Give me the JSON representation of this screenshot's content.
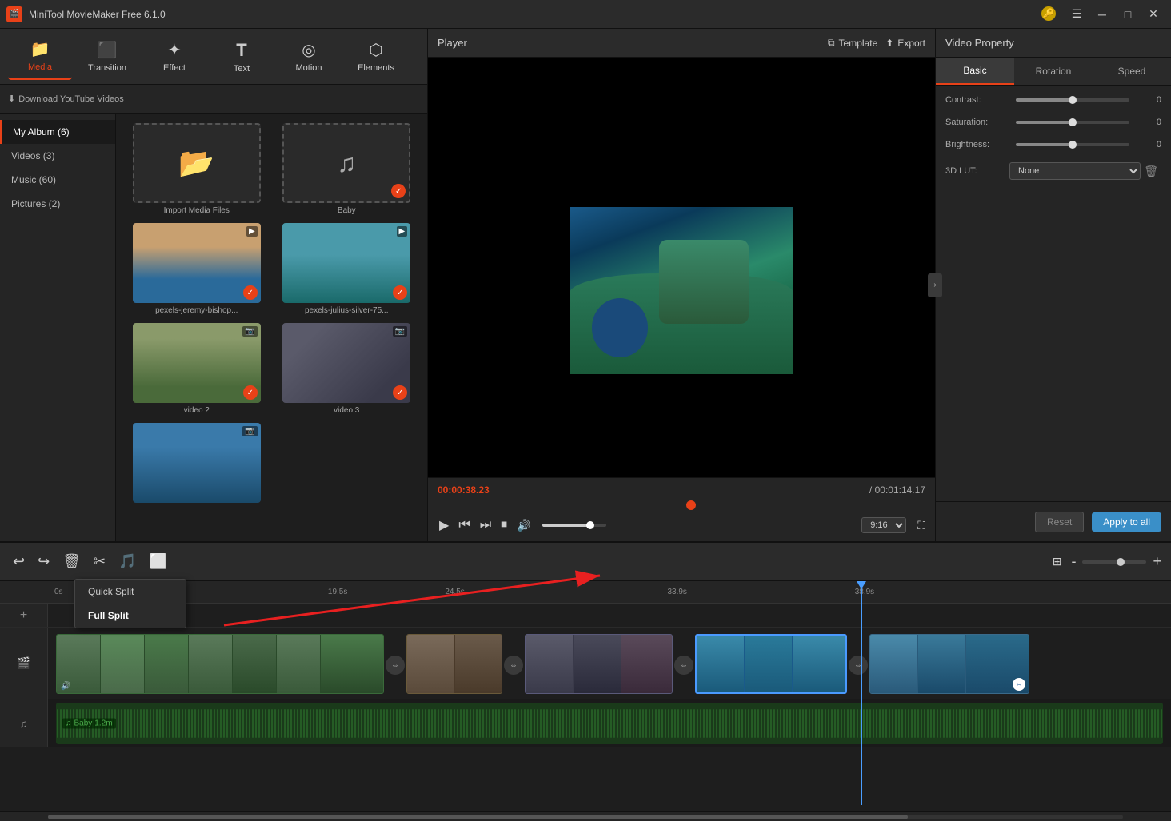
{
  "app": {
    "title": "MiniTool MovieMaker Free 6.1.0",
    "icon": "🎬"
  },
  "toolbar": {
    "items": [
      {
        "id": "media",
        "label": "Media",
        "icon": "📁",
        "active": true
      },
      {
        "id": "transition",
        "label": "Transition",
        "icon": "▶▶"
      },
      {
        "id": "effect",
        "label": "Effect",
        "icon": "✨"
      },
      {
        "id": "text",
        "label": "Text",
        "icon": "T"
      },
      {
        "id": "motion",
        "label": "Motion",
        "icon": "◎"
      },
      {
        "id": "elements",
        "label": "Elements",
        "icon": "⬡"
      }
    ]
  },
  "media_panel": {
    "download_btn": "Download YouTube Videos",
    "nav_items": [
      {
        "id": "album",
        "label": "My Album (6)",
        "active": true
      },
      {
        "id": "videos",
        "label": "Videos (3)"
      },
      {
        "id": "music",
        "label": "Music (60)"
      },
      {
        "id": "pictures",
        "label": "Pictures (2)"
      }
    ],
    "items": [
      {
        "id": "import",
        "label": "Import Media Files",
        "type": "import"
      },
      {
        "id": "baby",
        "label": "Baby",
        "type": "audio",
        "checked": true
      },
      {
        "id": "vid1",
        "label": "pexels-jeremy-bishop...",
        "type": "video",
        "checked": true
      },
      {
        "id": "vid2",
        "label": "pexels-julius-silver-75...",
        "type": "video",
        "checked": true
      },
      {
        "id": "vid3",
        "label": "video 2",
        "type": "video",
        "checked": true
      },
      {
        "id": "vid4",
        "label": "video 3",
        "type": "video",
        "checked": true
      },
      {
        "id": "vid5",
        "label": "",
        "type": "video",
        "checked": false
      }
    ]
  },
  "player": {
    "title": "Player",
    "template_btn": "Template",
    "export_btn": "Export",
    "current_time": "00:00:38.23",
    "total_time": "00:01:14.17",
    "aspect_ratio": "9:16",
    "seek_percent": 52,
    "volume_percent": 75
  },
  "property": {
    "title": "Video Property",
    "tabs": [
      "Basic",
      "Rotation",
      "Speed"
    ],
    "active_tab": "Basic",
    "fields": {
      "contrast": {
        "label": "Contrast:",
        "value": 0.0,
        "percent": 50
      },
      "saturation": {
        "label": "Saturation:",
        "value": 0.0,
        "percent": 50
      },
      "brightness": {
        "label": "Brightness:",
        "value": 0.0,
        "percent": 50
      },
      "lut": {
        "label": "3D LUT:",
        "value": "None"
      }
    },
    "reset_label": "Reset",
    "apply_all_label": "Apply to all"
  },
  "timeline": {
    "toolbar_btns": [
      "undo",
      "redo",
      "delete",
      "split",
      "audio",
      "crop"
    ],
    "split_menu": {
      "quick_split": "Quick Split",
      "full_split": "Full Split",
      "visible": true
    },
    "ruler_marks": [
      "0s",
      "19.5s",
      "24.5s",
      "33.9s",
      "38.9s"
    ],
    "playhead_pos": "71.8%",
    "tracks": [
      {
        "id": "video",
        "type": "video"
      },
      {
        "id": "music",
        "type": "music",
        "label": "Baby",
        "duration": "1.2m"
      }
    ]
  }
}
